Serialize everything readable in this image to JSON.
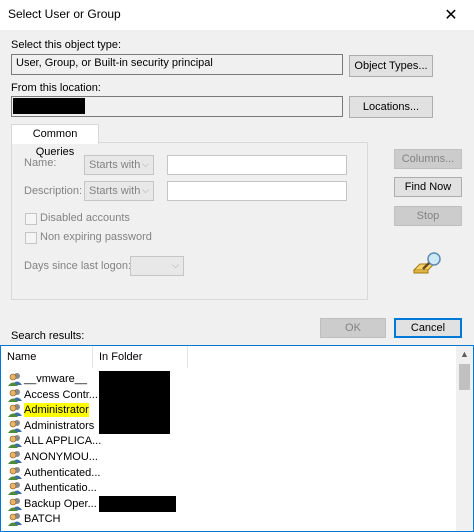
{
  "window": {
    "title": "Select User or Group",
    "close_glyph": "✕"
  },
  "object_type": {
    "label": "Select this object type:",
    "value": "User, Group, or Built-in security principal",
    "button": "Object Types..."
  },
  "location": {
    "label": "From this location:",
    "button": "Locations..."
  },
  "common_queries": {
    "tab": "Common Queries",
    "name_label": "Name:",
    "name_mode": "Starts with",
    "description_label": "Description:",
    "description_mode": "Starts with",
    "disabled_accounts": "Disabled accounts",
    "non_expiring_password": "Non expiring password",
    "days_since_logon": "Days since last logon:"
  },
  "side_buttons": {
    "columns": "Columns...",
    "find_now": "Find Now",
    "stop": "Stop"
  },
  "dialog_buttons": {
    "ok": "OK",
    "cancel": "Cancel"
  },
  "results": {
    "label": "Search results:",
    "columns": [
      "Name",
      "In Folder"
    ],
    "rows": [
      {
        "name": "__vmware__"
      },
      {
        "name": "Access Contr..."
      },
      {
        "name": "Administrator"
      },
      {
        "name": "Administrators"
      },
      {
        "name": "ALL APPLICA..."
      },
      {
        "name": "ANONYMOU..."
      },
      {
        "name": "Authenticated..."
      },
      {
        "name": "Authenticatio..."
      },
      {
        "name": "Backup Oper..."
      },
      {
        "name": "BATCH"
      }
    ]
  },
  "icons": {
    "query": "search-glass-icon",
    "user": "users-icon"
  }
}
